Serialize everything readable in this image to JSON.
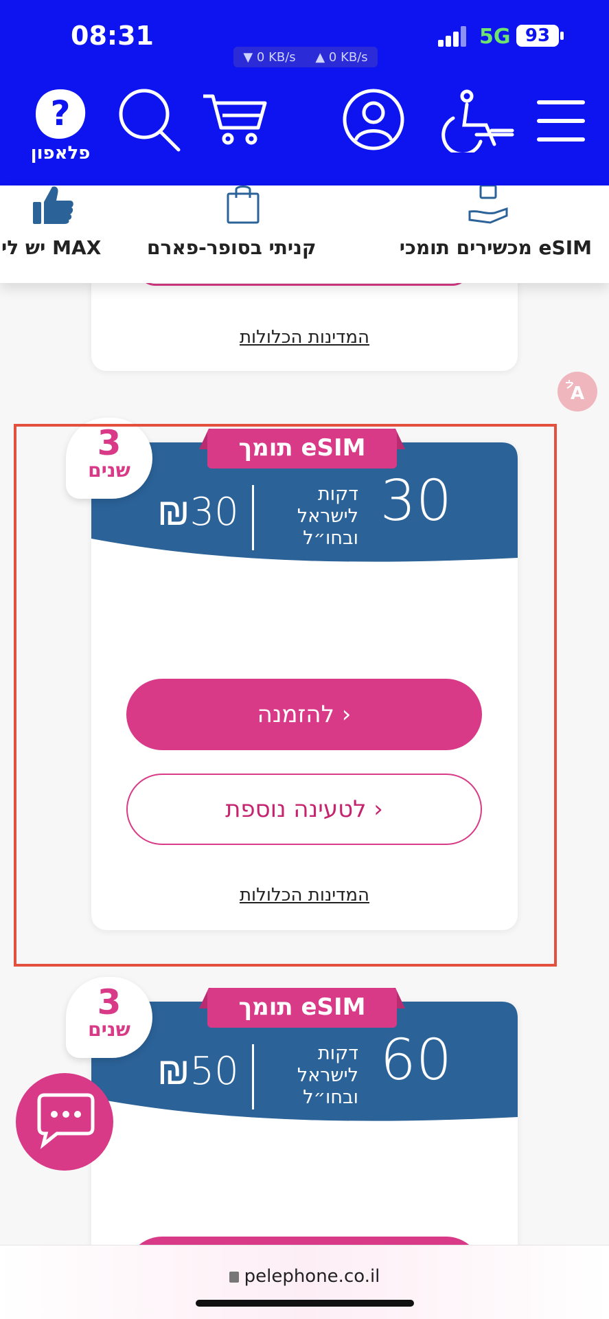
{
  "status_bar": {
    "time": "08:31",
    "net_down": "▼ 0 KB/s",
    "net_up": "▲ 0 KB/s",
    "network": "5G",
    "battery": "93"
  },
  "header": {
    "logo_text": "פלאפון",
    "icons": [
      "menu-icon",
      "accessibility-icon",
      "account-icon",
      "cart-icon",
      "search-icon",
      "logo-icon"
    ]
  },
  "categories": [
    {
      "label": "מכשירים תומכי eSIM",
      "icon": "chip-hand-icon"
    },
    {
      "label": "קניתי בסופר-פארם",
      "icon": "shopping-bag-icon"
    },
    {
      "label": "יש לי MAX",
      "icon": "thumbs-up-icon"
    }
  ],
  "prev_card": {
    "policy_link": "המדינות הכלולות"
  },
  "cards": [
    {
      "esim_tag": "תומך eSIM",
      "badge_number": "3",
      "badge_word": "שנים",
      "minutes": "30",
      "minutes_label": [
        "דקות",
        "לישראל",
        "ובחו״ל"
      ],
      "price": "₪30",
      "order_button": "להזמנה ›",
      "topup_button": "לטעינה נוספת ›",
      "policy_link": "המדינות הכלולות"
    },
    {
      "esim_tag": "תומך eSIM",
      "badge_number": "3",
      "badge_word": "שנים",
      "minutes": "60",
      "minutes_label": [
        "דקות",
        "לישראל",
        "ובחו״ל"
      ],
      "price": "₪50"
    }
  ],
  "browser": {
    "url": "pelephone.co.il"
  },
  "colors": {
    "header_blue": "#0d14f0",
    "pink": "#d93a87",
    "card_blue": "#2b6298",
    "highlight_red": "#e4503e"
  }
}
